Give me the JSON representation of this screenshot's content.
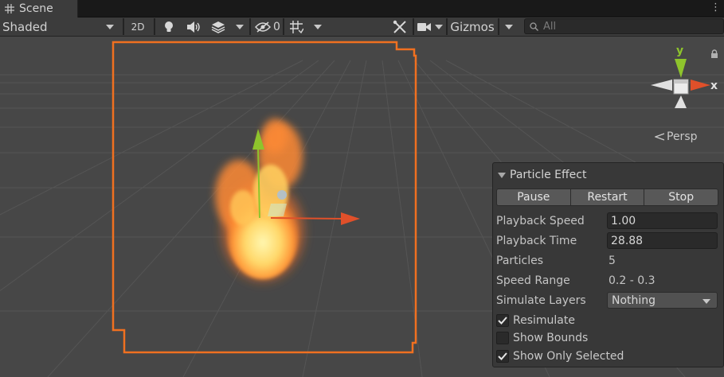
{
  "tab": {
    "label": "Scene",
    "icon": "grid-icon"
  },
  "toolbar": {
    "shading_mode": "Shaded",
    "mode_2d": "2D",
    "hidden_count": "0",
    "gizmos_label": "Gizmos",
    "search_placeholder": "All"
  },
  "viewport": {
    "projection_label": "Persp",
    "axis_y": "y",
    "axis_x": "x",
    "colors": {
      "selection": "#f07020",
      "axis_x": "#e0502a",
      "axis_y": "#8ec42c"
    }
  },
  "particle_panel": {
    "title": "Particle Effect",
    "buttons": {
      "pause": "Pause",
      "restart": "Restart",
      "stop": "Stop"
    },
    "playback_speed": {
      "label": "Playback Speed",
      "value": "1.00"
    },
    "playback_time": {
      "label": "Playback Time",
      "value": "28.88"
    },
    "particles": {
      "label": "Particles",
      "value": "5"
    },
    "speed_range": {
      "label": "Speed Range",
      "value": "0.2 - 0.3"
    },
    "simulate_layers": {
      "label": "Simulate Layers",
      "value": "Nothing"
    },
    "resimulate": {
      "label": "Resimulate",
      "checked": true
    },
    "show_bounds": {
      "label": "Show Bounds",
      "checked": false
    },
    "show_only_selected": {
      "label": "Show Only Selected",
      "checked": true
    }
  }
}
